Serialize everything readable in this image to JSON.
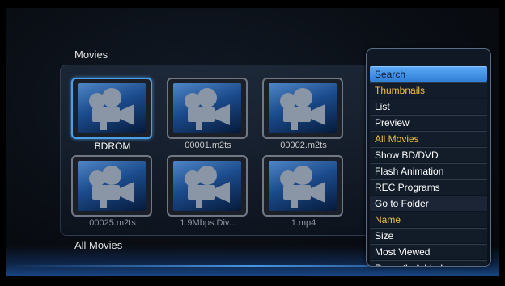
{
  "page": {
    "title": "Movies",
    "footer_label": "All Movies"
  },
  "grid": {
    "items": [
      {
        "label": "BDROM",
        "selected": true
      },
      {
        "label": "00001.m2ts",
        "selected": false
      },
      {
        "label": "00002.m2ts",
        "selected": false
      },
      {
        "label": "00025.m2ts",
        "selected": false
      },
      {
        "label": "1.9Mbps.Div...",
        "selected": false
      },
      {
        "label": "1.mp4",
        "selected": false
      }
    ]
  },
  "menu": {
    "items": [
      {
        "label": "Search",
        "kind": "active"
      },
      {
        "label": "Thumbnails",
        "kind": "header"
      },
      {
        "label": "List",
        "kind": "item"
      },
      {
        "label": "Preview",
        "kind": "item"
      },
      {
        "label": "All Movies",
        "kind": "header"
      },
      {
        "label": "Show BD/DVD",
        "kind": "item"
      },
      {
        "label": "Flash Animation",
        "kind": "item"
      },
      {
        "label": "REC Programs",
        "kind": "item"
      },
      {
        "label": "Go to Folder",
        "kind": "item"
      },
      {
        "label": "Name",
        "kind": "header"
      },
      {
        "label": "Size",
        "kind": "item"
      },
      {
        "label": "Most Viewed",
        "kind": "item"
      },
      {
        "label": "Recently Added",
        "kind": "item"
      }
    ]
  },
  "icons": {
    "thumbnail": "movie-camera-icon"
  },
  "colors": {
    "accent": "#4a9fe6",
    "header": "#f0c23a",
    "menu_active": "#3a8de0"
  }
}
